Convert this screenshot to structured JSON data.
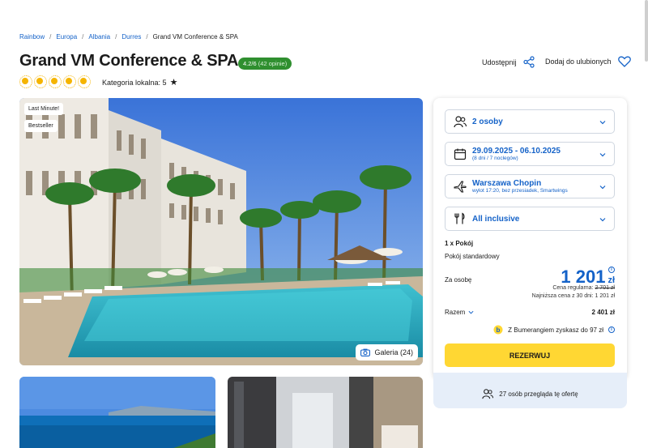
{
  "breadcrumb": [
    "Rainbow",
    "Europa",
    "Albania",
    "Durres",
    "Grand VM Conference & SPA"
  ],
  "hotel": {
    "title": "Grand VM Conference & SPA",
    "rating": "4.2/6",
    "rating_count": "(42 opinie)",
    "category_label": "Kategoria lokalna: 5"
  },
  "actions": {
    "share": "Udostępnij",
    "favorite": "Dodaj do ulubionych"
  },
  "hero": {
    "tags": [
      "Last Minute!",
      "Bestseller"
    ],
    "gallery_label": "Galeria (24)"
  },
  "booking": {
    "persons": "2 osoby",
    "dates": "29.09.2025 - 06.10.2025",
    "dates_sub": "(8 dni / 7 noclegów)",
    "airport": "Warszawa Chopin",
    "airport_sub": "wylot 17:20, bez przesiadek, Smartwings",
    "board": "All inclusive",
    "room_count": "1 x Pokój",
    "room_type": "Pokój standardowy",
    "per_person_label": "Za osobę",
    "price": "1 201",
    "currency": "zł",
    "regular_label": "Cena regularna:",
    "regular_price": "2 701 zł",
    "lowest_30": "Najniższa cena z 30 dni: 1 201 zł",
    "total_label": "Razem",
    "total": "2 401 zł",
    "bumerang": "Z Bumerangiem zyskasz do 97 zł",
    "reserve": "REZERWUJ",
    "viewers": "27 osób przegląda tę ofertę"
  },
  "colors": {
    "accent": "#1462c8",
    "cta": "#ffd733",
    "rating_bg": "#2f8f2f",
    "sun": "#f5b400"
  }
}
